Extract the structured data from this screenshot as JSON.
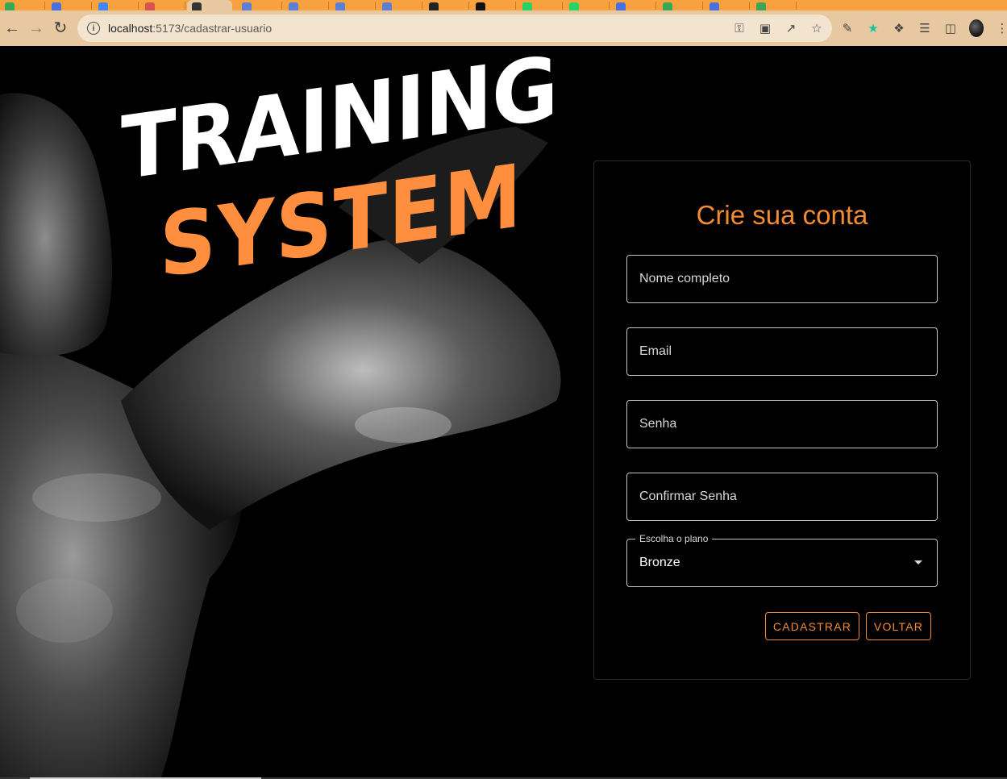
{
  "browser": {
    "url_host": "localhost",
    "url_rest": ":5173/cadastrar-usuario",
    "tab_color": "#f7a13f",
    "toolbar_color": "#e8c8a0"
  },
  "hero": {
    "logo_line1": "TRAINING",
    "logo_line2": "SYSTEM",
    "logo_line1_color": "#ffffff",
    "logo_line2_color": "#ff8f3f"
  },
  "form": {
    "title": "Crie sua conta",
    "fields": {
      "name_placeholder": "Nome completo",
      "email_placeholder": "Email",
      "password_placeholder": "Senha",
      "confirm_placeholder": "Confirmar Senha"
    },
    "plan": {
      "label": "Escolha o plano",
      "value": "Bronze"
    },
    "buttons": {
      "submit": "CADASTRAR",
      "back": "VOLTAR"
    },
    "accent_color": "#f28b32"
  }
}
